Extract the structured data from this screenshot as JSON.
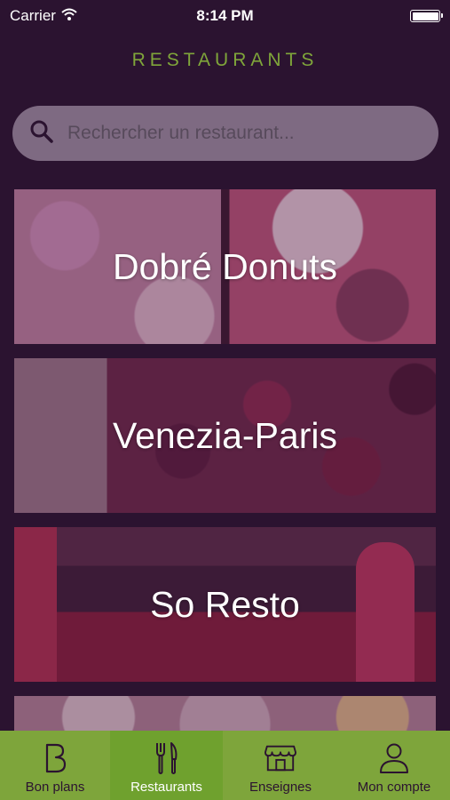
{
  "status_bar": {
    "carrier": "Carrier",
    "time": "8:14 PM"
  },
  "nav": {
    "title": "RESTAURANTS"
  },
  "search": {
    "placeholder": "Rechercher un restaurant..."
  },
  "restaurants": [
    {
      "name": "Dobré Donuts"
    },
    {
      "name": "Venezia-Paris"
    },
    {
      "name": "So Resto"
    }
  ],
  "tabs": [
    {
      "label": "Bon plans",
      "icon": "letter-b-icon"
    },
    {
      "label": "Restaurants",
      "icon": "fork-knife-icon"
    },
    {
      "label": "Enseignes",
      "icon": "storefront-icon"
    },
    {
      "label": "Mon compte",
      "icon": "user-icon"
    }
  ],
  "colors": {
    "accent": "#7ea53b",
    "active_tab": "#6fa12e",
    "background": "#2b1330",
    "title": "#7fa53a"
  }
}
